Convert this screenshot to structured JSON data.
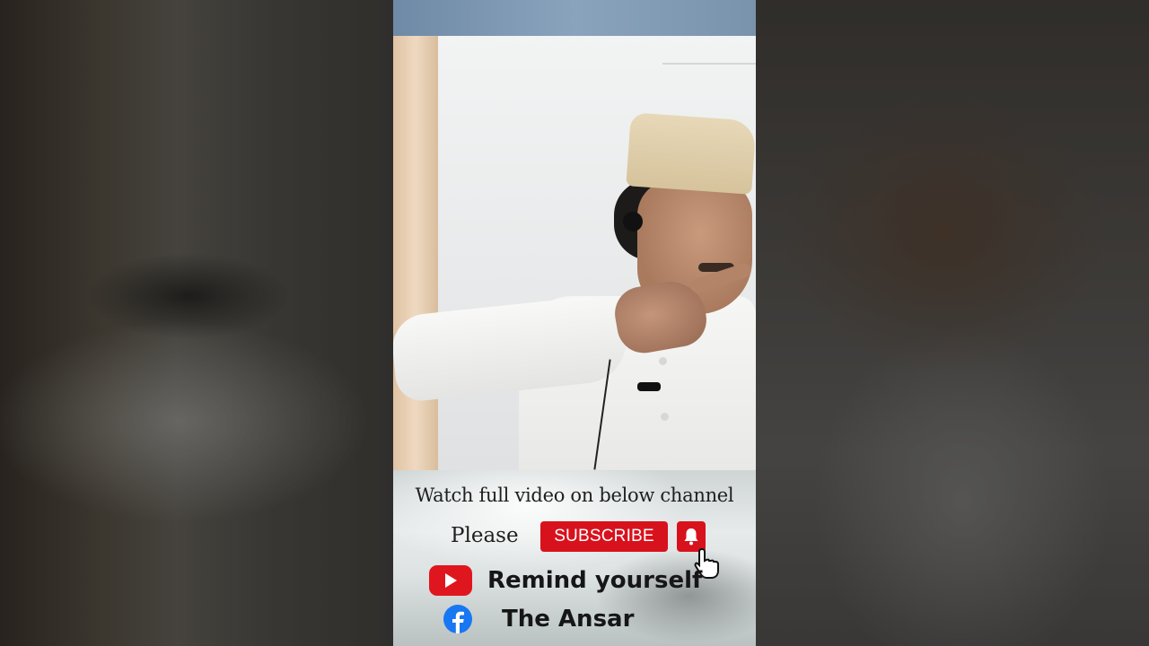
{
  "banner": {
    "headline": "Watch full video on below channel",
    "please": "Please",
    "subscribe_label": "SUBSCRIBE",
    "youtube_channel": "Remind yourself",
    "facebook_page": "The Ansar"
  },
  "icons": [
    "bell-icon",
    "hand-cursor-icon",
    "youtube-icon",
    "facebook-icon"
  ],
  "colors": {
    "subscribe_red": "#d8121d",
    "youtube_red": "#e0161e",
    "facebook_blue": "#1877f2"
  }
}
